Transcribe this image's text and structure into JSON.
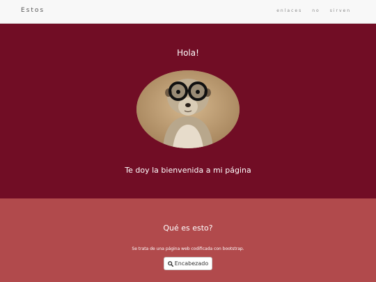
{
  "navbar": {
    "brand": "Estos",
    "links": [
      "enlaces",
      "no",
      "sirven"
    ]
  },
  "hero": {
    "greeting": "Hola!",
    "welcome": "Te doy la bienvenida a mi página"
  },
  "section": {
    "title": "Qué es esto?",
    "text": "Se trata de una página web codificada con bootstrap.",
    "button_label": "Encabezado",
    "button_icon": "search-icon"
  },
  "colors": {
    "hero_bg": "#710d25",
    "section_bg": "#b14a4c",
    "navbar_bg": "#f8f8f8"
  }
}
